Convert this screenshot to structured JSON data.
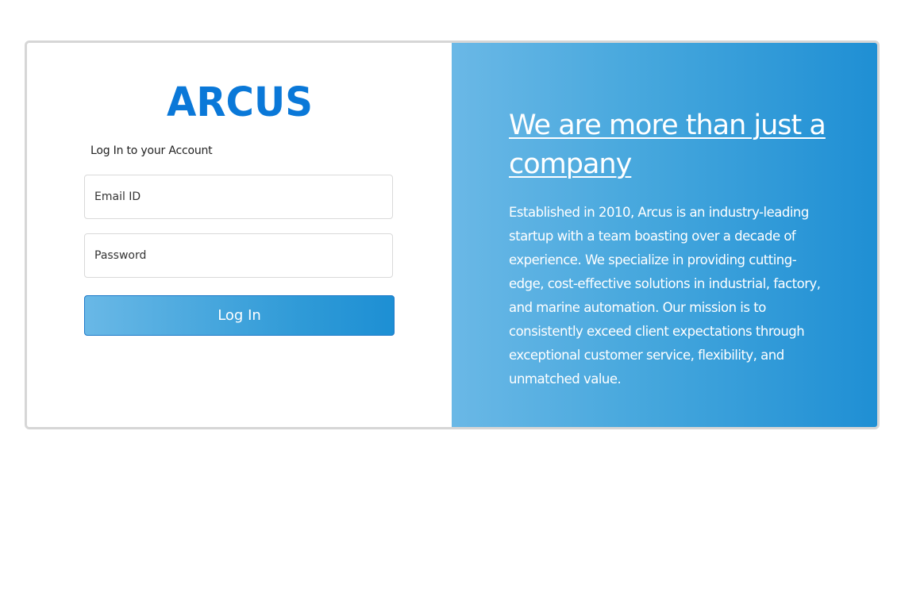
{
  "brand": {
    "logo_text": "ARCUS",
    "color": "#0a78d8"
  },
  "login": {
    "subtitle": "Log In to your Account",
    "email_placeholder": "Email ID",
    "password_placeholder": "Password",
    "button_label": "Log In"
  },
  "promo": {
    "headline": "We are more than just a company",
    "body": "Established in 2010, Arcus is an industry-leading startup with a team boasting over a decade of experience. We specialize in providing cutting-edge, cost-effective solutions in industrial, factory, and marine automation. Our mission is to consistently exceed client expectations through exceptional customer service, flexibility, and unmatched value."
  },
  "colors": {
    "gradient_start": "#6ab8e6",
    "gradient_end": "#1f8fd4",
    "card_border": "#d6d6d6"
  }
}
